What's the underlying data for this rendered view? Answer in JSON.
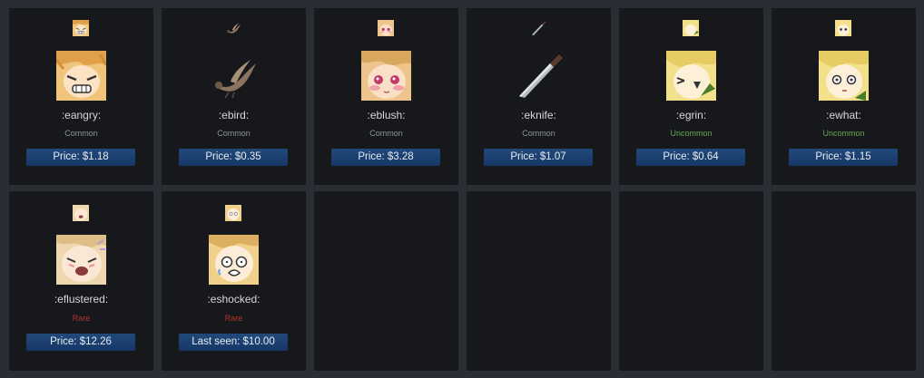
{
  "items": [
    {
      "name": ":eangry:",
      "rarity": "Common",
      "rarity_color": "#8f9296",
      "price": "Price: $1.18",
      "icon": "eangry-emoticon-icon"
    },
    {
      "name": ":ebird:",
      "rarity": "Common",
      "rarity_color": "#8f9296",
      "price": "Price: $0.35",
      "icon": "bird-icon"
    },
    {
      "name": ":eblush:",
      "rarity": "Common",
      "rarity_color": "#8f9296",
      "price": "Price: $3.28",
      "icon": "eblush-emoticon-icon"
    },
    {
      "name": ":eknife:",
      "rarity": "Common",
      "rarity_color": "#8f9296",
      "price": "Price: $1.07",
      "icon": "knife-icon"
    },
    {
      "name": ":egrin:",
      "rarity": "Uncommon",
      "rarity_color": "#6aa84f",
      "price": "Price: $0.64",
      "icon": "egrin-emoticon-icon"
    },
    {
      "name": ":ewhat:",
      "rarity": "Uncommon",
      "rarity_color": "#6aa84f",
      "price": "Price: $1.15",
      "icon": "ewhat-emoticon-icon"
    },
    {
      "name": ":eflustered:",
      "rarity": "Rare",
      "rarity_color": "#b5332b",
      "price": "Price: $12.26",
      "icon": "eflustered-emoticon-icon"
    },
    {
      "name": ":eshocked:",
      "rarity": "Rare",
      "rarity_color": "#b5332b",
      "price": "Last seen: $10.00",
      "icon": "eshocked-emoticon-icon"
    }
  ]
}
